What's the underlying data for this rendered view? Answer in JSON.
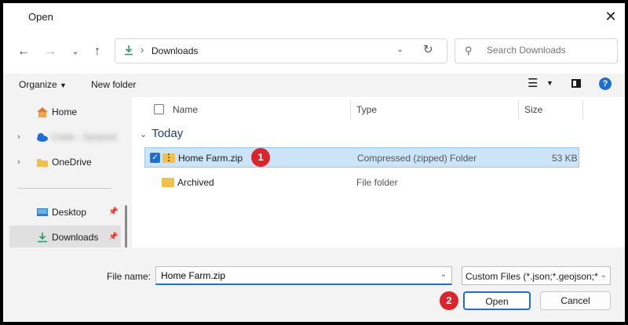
{
  "window": {
    "title": "Open",
    "close_glyph": "✕"
  },
  "nav": {
    "back_icon": "arrow-left-icon",
    "forward_icon": "arrow-right-icon",
    "recent_icon": "chevron-down-icon",
    "up_icon": "arrow-up-icon",
    "breadcrumb": [
      "Downloads"
    ],
    "search_placeholder": "Search Downloads"
  },
  "toolbar": {
    "organize_label": "Organize",
    "new_folder_label": "New folder"
  },
  "sidebar": {
    "items": [
      {
        "label": "Home",
        "icon": "home-icon",
        "expandable": false
      },
      {
        "label": "Cobb - Synpost",
        "icon": "cloud-icon",
        "expandable": true,
        "blurred": true
      },
      {
        "label": "OneDrive",
        "icon": "folder-icon",
        "expandable": true
      },
      {
        "label": "Desktop",
        "icon": "desktop-icon",
        "pinned": true
      },
      {
        "label": "Downloads",
        "icon": "download-icon",
        "pinned": true,
        "active": true
      }
    ]
  },
  "file_list": {
    "columns": [
      "Name",
      "Type",
      "Size"
    ],
    "group": "Today",
    "rows": [
      {
        "name": "Home Farm.zip",
        "type": "Compressed (zipped) Folder",
        "size": "53 KB",
        "selected": true,
        "icon": "zip-folder-icon"
      },
      {
        "name": "Archived",
        "type": "File folder",
        "size": "",
        "selected": false,
        "icon": "folder-icon"
      }
    ]
  },
  "bottom": {
    "file_name_label": "File name:",
    "file_name_value": "Home Farm.zip",
    "filter_value": "Custom Files (*.json;*.geojson;*",
    "open_label": "Open",
    "cancel_label": "Cancel"
  },
  "annotations": {
    "step1": "1",
    "step2": "2"
  },
  "colors": {
    "accent": "#1f6fd1",
    "selection": "#cce4f7",
    "badge": "#d9262c",
    "folder": "#f1c04b"
  }
}
